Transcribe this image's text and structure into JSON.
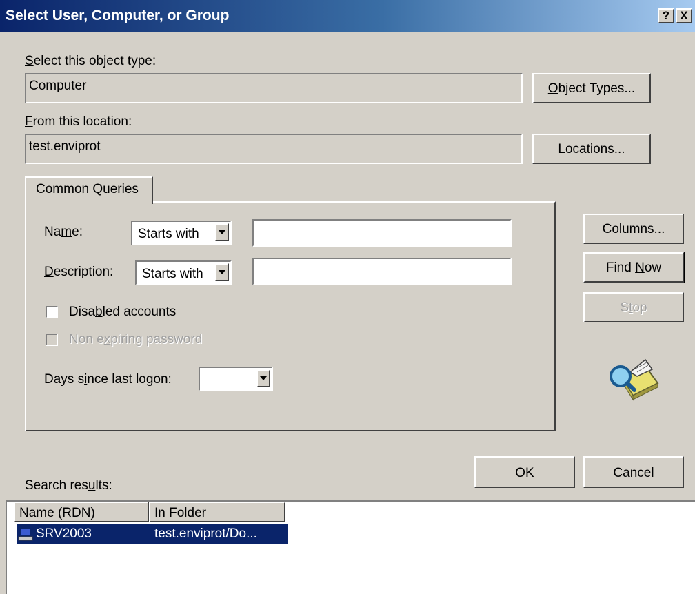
{
  "window": {
    "title": "Select User, Computer, or Group",
    "help_btn": "?",
    "close_btn": "X"
  },
  "object_type": {
    "label_u": "S",
    "label_rest": "elect this object type:",
    "value": "Computer",
    "button_u": "O",
    "button_rest": "bject Types..."
  },
  "location": {
    "label_u": "F",
    "label_rest": "rom this location:",
    "value": "test.enviprot",
    "button_u": "L",
    "button_rest": "ocations..."
  },
  "tab": {
    "label": "Common Queries"
  },
  "query": {
    "name_label_a": "Na",
    "name_label_u": "m",
    "name_label_b": "e:",
    "name_combo": "Starts with",
    "name_value": "",
    "desc_label_u": "D",
    "desc_label_b": "escription:",
    "desc_combo": "Starts with",
    "desc_value": "",
    "disabled_label_a": "Disa",
    "disabled_label_u": "b",
    "disabled_label_b": "led accounts",
    "nonexp_label_a": "Non e",
    "nonexp_label_u": "x",
    "nonexp_label_b": "piring password",
    "days_label_a": "Days s",
    "days_label_u": "i",
    "days_label_b": "nce last logon:",
    "days_value": ""
  },
  "side_buttons": {
    "columns_u": "C",
    "columns_rest": "olumns...",
    "findnow_a": "Find ",
    "findnow_u": "N",
    "findnow_b": "ow",
    "stop_a": "S",
    "stop_u": "t",
    "stop_b": "op"
  },
  "footer": {
    "ok": "OK",
    "cancel": "Cancel",
    "results_label_a": "Search res",
    "results_label_u": "u",
    "results_label_b": "lts:"
  },
  "results": {
    "columns": [
      "Name (RDN)",
      "In Folder"
    ],
    "rows": [
      {
        "name": "SRV2003",
        "folder": "test.enviprot/Do..."
      }
    ]
  },
  "icons": {
    "search": "search-computer-icon",
    "computer": "computer-icon"
  }
}
